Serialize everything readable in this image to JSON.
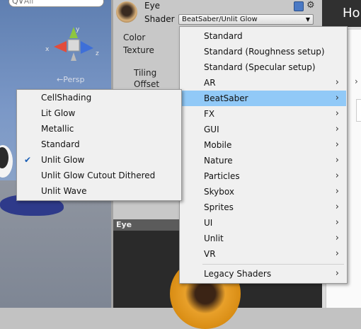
{
  "scene": {
    "search_placeholder": "All",
    "persp_label": "←Persp",
    "gizmo_axes": {
      "x": "x",
      "y": "y",
      "z": "z"
    }
  },
  "inspector": {
    "object_name": "Eye",
    "shader_label": "Shader",
    "shader_value": "BeatSaber/Unlit Glow",
    "color_label": "Color",
    "texture_label": "Texture",
    "tiling_label": "Tiling",
    "offset_label": "Offset"
  },
  "preview": {
    "title": "Eye"
  },
  "right_panel": {
    "header_text": "Ho",
    "chevron": "›"
  },
  "shader_menu": {
    "items": [
      {
        "label": "Standard",
        "submenu": false
      },
      {
        "label": "Standard (Roughness setup)",
        "submenu": false
      },
      {
        "label": "Standard (Specular setup)",
        "submenu": false
      },
      {
        "label": "AR",
        "submenu": true
      },
      {
        "label": "BeatSaber",
        "submenu": true,
        "highlighted": true
      },
      {
        "label": "FX",
        "submenu": true
      },
      {
        "label": "GUI",
        "submenu": true
      },
      {
        "label": "Mobile",
        "submenu": true
      },
      {
        "label": "Nature",
        "submenu": true
      },
      {
        "label": "Particles",
        "submenu": true
      },
      {
        "label": "Skybox",
        "submenu": true
      },
      {
        "label": "Sprites",
        "submenu": true
      },
      {
        "label": "UI",
        "submenu": true
      },
      {
        "label": "Unlit",
        "submenu": true
      },
      {
        "label": "VR",
        "submenu": true
      },
      {
        "label": "Legacy Shaders",
        "submenu": true
      }
    ]
  },
  "beatsaber_submenu": {
    "items": [
      {
        "label": "CellShading",
        "checked": false
      },
      {
        "label": "Lit Glow",
        "checked": false
      },
      {
        "label": "Metallic",
        "checked": false
      },
      {
        "label": "Standard",
        "checked": false
      },
      {
        "label": "Unlit Glow",
        "checked": true
      },
      {
        "label": "Unlit Glow Cutout Dithered",
        "checked": false
      },
      {
        "label": "Unlit Wave",
        "checked": false
      }
    ]
  },
  "glyphs": {
    "chevron": "›",
    "check": "✔",
    "dropdown_arrow": "▼",
    "gear": "⚙",
    "search": "Q∨"
  },
  "colors": {
    "highlight": "#91c9f7",
    "menu_bg": "#f0f0f0",
    "check": "#1b5fb5"
  }
}
